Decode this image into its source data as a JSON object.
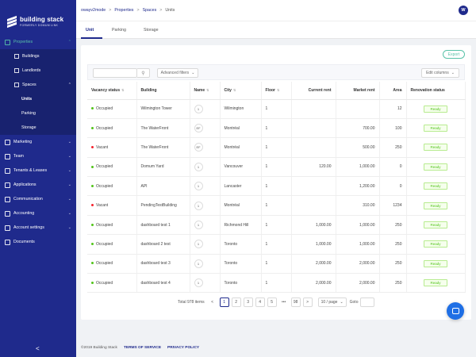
{
  "brand": {
    "title": "building stack",
    "subtitle": "FORMERLY DOMUM LINK"
  },
  "sidebar": {
    "properties": "Properties",
    "buildings": "Buildings",
    "landlords": "Landlords",
    "spaces": "Spaces",
    "units": "Units",
    "parking": "Parking",
    "storage": "Storage",
    "marketing": "Marketing",
    "team": "Team",
    "tenants": "Tenants & Leases",
    "applications": "Applications",
    "communication": "Communication",
    "accounting": "Accounting",
    "account_settings": "Account settings",
    "documents": "Documents",
    "collapse": "<"
  },
  "breadcrumb": {
    "c1": "owayv2mode",
    "c2": "Properties",
    "c3": "Spaces",
    "c4": "Units",
    "sep": ">"
  },
  "avatar": "W",
  "tabs": {
    "unit": "Unit",
    "parking": "Parking",
    "storage": "Storage"
  },
  "toolbar": {
    "export": "Export",
    "advanced": "Advanced filters",
    "edit_columns": "Edit columns",
    "search_placeholder": ""
  },
  "columns": {
    "vacancy": "Vacancy status",
    "building": "Building",
    "name": "Name",
    "city": "City",
    "floor": "Floor",
    "current_rent": "Current rent",
    "market_rent": "Market rent",
    "area": "Area",
    "renovation": "Renovation status"
  },
  "rows": [
    {
      "status": "Occupied",
      "status_color": "#52c41a",
      "building": "Wilmington Tower",
      "name": "1",
      "city": "Wilmington",
      "floor": "1",
      "current": "",
      "market": "",
      "area": "12",
      "renovation": "Ready"
    },
    {
      "status": "Occupied",
      "status_color": "#52c41a",
      "building": "The WaterFront",
      "name": "EF",
      "city": "Montréal",
      "floor": "1",
      "current": "",
      "market": "700.00",
      "area": "100",
      "renovation": "Ready"
    },
    {
      "status": "Vacant",
      "status_color": "#f5222d",
      "building": "The WaterFront",
      "name": "EF",
      "city": "Montréal",
      "floor": "1",
      "current": "",
      "market": "500.00",
      "area": "250",
      "renovation": "Ready"
    },
    {
      "status": "Occupied",
      "status_color": "#52c41a",
      "building": "Domum Yard",
      "name": "1",
      "city": "Vancouver",
      "floor": "1",
      "current": "120.00",
      "market": "1,000.00",
      "area": "0",
      "renovation": "Ready"
    },
    {
      "status": "Occupied",
      "status_color": "#52c41a",
      "building": "API",
      "name": "1",
      "city": "Lancaster",
      "floor": "1",
      "current": "",
      "market": "1,200.00",
      "area": "0",
      "renovation": "Ready"
    },
    {
      "status": "Vacant",
      "status_color": "#f5222d",
      "building": "PendingTestBuilding",
      "name": "1",
      "city": "Montréal",
      "floor": "1",
      "current": "",
      "market": "310.00",
      "area": "1234",
      "renovation": "Ready"
    },
    {
      "status": "Occupied",
      "status_color": "#52c41a",
      "building": "dashboard test 1",
      "name": "1",
      "city": "Richmond Hill",
      "floor": "1",
      "current": "1,000.00",
      "market": "1,000.00",
      "area": "250",
      "renovation": "Ready"
    },
    {
      "status": "Occupied",
      "status_color": "#52c41a",
      "building": "dashboard 2 test",
      "name": "1",
      "city": "Toronto",
      "floor": "1",
      "current": "1,000.00",
      "market": "1,000.00",
      "area": "250",
      "renovation": "Ready"
    },
    {
      "status": "Occupied",
      "status_color": "#52c41a",
      "building": "dashboard test 3",
      "name": "1",
      "city": "Toronto",
      "floor": "1",
      "current": "2,000.00",
      "market": "2,000.00",
      "area": "250",
      "renovation": "Ready"
    },
    {
      "status": "Occupied",
      "status_color": "#52c41a",
      "building": "dashboard test 4",
      "name": "1",
      "city": "Toronto",
      "floor": "1",
      "current": "2,000.00",
      "market": "2,000.00",
      "area": "250",
      "renovation": "Ready"
    }
  ],
  "pagination": {
    "total": "Total 978 items",
    "prev": "<",
    "p1": "1",
    "p2": "2",
    "p3": "3",
    "p4": "4",
    "p5": "5",
    "ellipsis": "•••",
    "last": "98",
    "next": ">",
    "page_size": "10 / page",
    "goto": "Goto"
  },
  "footer": {
    "copyright": "©2019 Building Stack",
    "terms": "TERMS OF SERVICE",
    "privacy": "PRIVACY POLICY"
  },
  "colors": {
    "sidebar": "#1f2a8c",
    "accent": "#58c2a8",
    "vacant": "#f5222d",
    "occupied": "#52c41a",
    "chat": "#1f6fe5"
  }
}
